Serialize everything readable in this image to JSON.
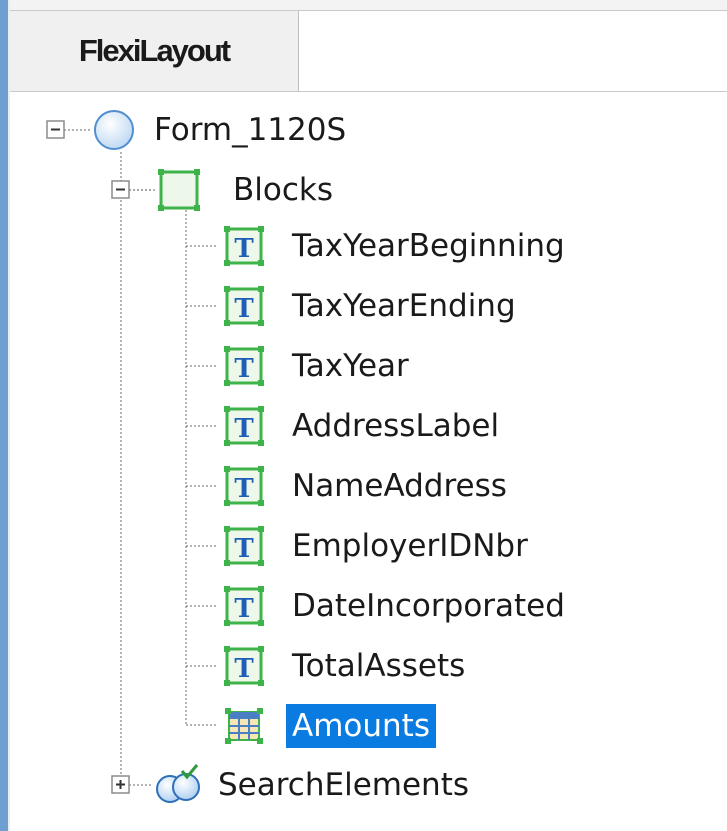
{
  "tab": {
    "label": "FlexiLayout"
  },
  "tree": {
    "root": {
      "label": "Form_1120S",
      "icon": "circle-node-icon",
      "expanded": true
    },
    "blocks": {
      "label": "Blocks",
      "icon": "block-square-icon",
      "expanded": true
    },
    "items": [
      {
        "label": "TaxYearBeginning",
        "icon": "text-block-icon"
      },
      {
        "label": "TaxYearEnding",
        "icon": "text-block-icon"
      },
      {
        "label": "TaxYear",
        "icon": "text-block-icon"
      },
      {
        "label": "AddressLabel",
        "icon": "text-block-icon"
      },
      {
        "label": "NameAddress",
        "icon": "text-block-icon"
      },
      {
        "label": "EmployerIDNbr",
        "icon": "text-block-icon"
      },
      {
        "label": "DateIncorporated",
        "icon": "text-block-icon"
      },
      {
        "label": "TotalAssets",
        "icon": "text-block-icon"
      },
      {
        "label": "Amounts",
        "icon": "table-block-icon",
        "selected": true
      }
    ],
    "search": {
      "label": "SearchElements",
      "icon": "search-elements-icon",
      "expanded": false
    }
  },
  "colors": {
    "selection": "#0a7be0",
    "icon_green": "#3db34a",
    "icon_blue": "#1f5fb5",
    "accent_border": "#6f9fd0"
  }
}
